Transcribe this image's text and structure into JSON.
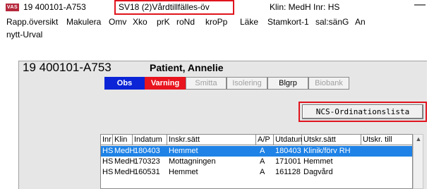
{
  "titlebar": {
    "logo_text": "VAS",
    "patient_id": "19 400101-A753",
    "unit": "SV18 (2)Vårdtillfälles-öv",
    "clinic": "Klin: MedH  Inr: HS",
    "minimize": "—"
  },
  "menu": [
    "Rapp.översikt",
    "Makulera",
    "Omv",
    "Xko",
    "prK",
    "roNd",
    "kroPp",
    "Läke",
    "Stamkort-1",
    "sal:sänG",
    "An",
    "nytt-Urval"
  ],
  "patient": {
    "id": "19 400101-A753",
    "name": "Patient, Annelie"
  },
  "flags": {
    "obs": "Obs",
    "varning": "Varning",
    "smitta": "Smitta",
    "isolering": "Isolering",
    "blgrp": "Blgrp",
    "biobank": "Biobank"
  },
  "colors": {
    "highlight": "#e0141e",
    "obs": "#0a24d6",
    "varning": "#e8141e",
    "selected_row": "#1e82e6"
  },
  "ncs_button": "NCS-Ordinationslista",
  "table": {
    "columns": [
      "Inr",
      "Klin",
      "Indatum",
      "Inskr.sätt",
      "A/P",
      "Utdatum",
      "Utskr.sätt",
      "Utskr. till"
    ],
    "rows": [
      [
        "HS",
        "MedH",
        "180403",
        "Hemmet",
        "A",
        "180403",
        "Klinik/förv RH",
        ""
      ],
      [
        "HS",
        "MedH",
        "170323",
        "Mottagningen",
        "A",
        "171001",
        "Hemmet",
        ""
      ],
      [
        "HS",
        "MedH",
        "160531",
        "Hemmet",
        "A",
        "161128",
        "Dagvård",
        ""
      ]
    ]
  }
}
